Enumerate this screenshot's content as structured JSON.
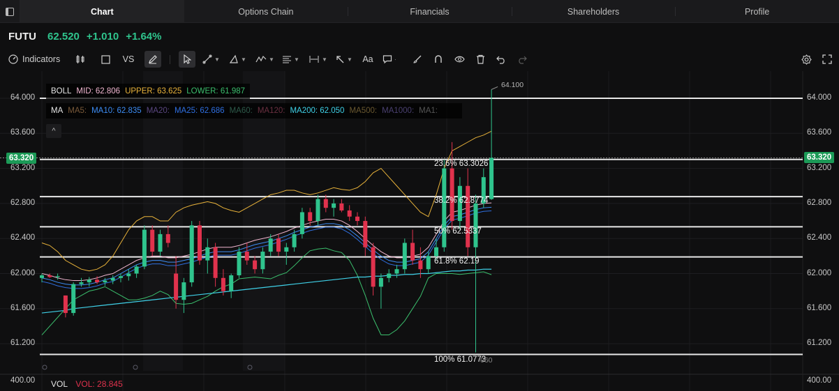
{
  "tabs": [
    {
      "label": "Chart"
    },
    {
      "label": "Options Chain"
    },
    {
      "label": "Financials"
    },
    {
      "label": "Shareholders"
    },
    {
      "label": "Profile"
    }
  ],
  "quote": {
    "symbol": "FUTU",
    "price": "62.520",
    "change": "+1.010",
    "change_pct": "+1.64%"
  },
  "toolbar": {
    "indicators_label": "Indicators",
    "compare_label": "VS",
    "text_label": "Aa"
  },
  "axis": {
    "left_ticks": [
      "64.000",
      "63.600",
      "63.200",
      "62.800",
      "62.400",
      "62.000",
      "61.600",
      "61.200"
    ],
    "right_ticks": [
      "64.000",
      "63.600",
      "63.200",
      "62.800",
      "62.400",
      "62.000",
      "61.600",
      "61.200"
    ],
    "current_price": "63.320",
    "volume_tick": "400.00"
  },
  "boll": {
    "label": "BOLL",
    "mid": "MID: 62.806",
    "upper": "UPPER: 63.625",
    "lower": "LOWER: 61.987"
  },
  "ma": {
    "label": "MA",
    "items": [
      "MA5:",
      "MA10: 62.835",
      "MA20:",
      "MA25: 62.686",
      "MA60:",
      "MA120:",
      "MA200: 62.050",
      "MA500:",
      "MA1000:",
      "MA1:"
    ]
  },
  "fib": {
    "l236": "23.6% 63.3026",
    "l382": "38.2% 62.8774",
    "l50": "50% 62.5337",
    "l618": "61.8% 62.19",
    "l100": "100% 61.0773",
    "overlap_label": "060"
  },
  "high_label": "64.100",
  "volume": {
    "label": "VOL",
    "value": "VOL: 28.845"
  },
  "colors": {
    "up": "#2fc48d",
    "down": "#e0324d",
    "boll_mid": "#f0b6d0",
    "boll_upper": "#e8b23a",
    "boll_lower": "#3bbf6d",
    "ma10": "#3d8df5",
    "ma25": "#2f6fe0",
    "ma200": "#3fd1e8"
  },
  "chart_data": {
    "type": "candlestick",
    "y_range": [
      61.0,
      64.1
    ],
    "bars": [
      [
        61.95,
        62.0,
        61.9,
        61.98
      ],
      [
        61.98,
        62.0,
        61.95,
        61.96
      ],
      [
        61.96,
        62.0,
        61.93,
        61.97
      ],
      [
        61.75,
        61.75,
        61.5,
        61.55
      ],
      [
        61.55,
        61.9,
        61.52,
        61.88
      ],
      [
        61.88,
        61.95,
        61.85,
        61.9
      ],
      [
        61.9,
        61.96,
        61.85,
        61.93
      ],
      [
        61.93,
        61.97,
        61.88,
        61.9
      ],
      [
        61.9,
        61.95,
        61.86,
        61.92
      ],
      [
        61.92,
        61.98,
        61.88,
        61.95
      ],
      [
        61.95,
        62.0,
        61.9,
        61.97
      ],
      [
        61.97,
        62.05,
        61.92,
        62.0
      ],
      [
        62.0,
        62.1,
        61.95,
        62.08
      ],
      [
        62.08,
        62.55,
        62.05,
        62.5
      ],
      [
        62.5,
        62.55,
        62.2,
        62.25
      ],
      [
        62.25,
        62.5,
        62.2,
        62.45
      ],
      [
        62.45,
        62.55,
        62.3,
        62.35
      ],
      [
        62.0,
        62.2,
        61.6,
        61.7
      ],
      [
        61.7,
        61.95,
        61.55,
        61.9
      ],
      [
        61.9,
        62.6,
        61.85,
        62.55
      ],
      [
        62.55,
        62.6,
        62.1,
        62.15
      ],
      [
        62.15,
        62.4,
        62.0,
        62.3
      ],
      [
        62.3,
        62.35,
        61.85,
        61.95
      ],
      [
        61.95,
        62.05,
        61.75,
        61.8
      ],
      [
        61.8,
        62.0,
        61.72,
        61.98
      ],
      [
        61.98,
        62.3,
        61.95,
        62.25
      ],
      [
        62.25,
        62.35,
        62.1,
        62.15
      ],
      [
        62.15,
        62.2,
        62.0,
        62.05
      ],
      [
        62.05,
        62.3,
        62.0,
        62.25
      ],
      [
        62.25,
        62.45,
        62.2,
        62.4
      ],
      [
        62.4,
        62.45,
        62.2,
        62.25
      ],
      [
        62.25,
        62.35,
        62.1,
        62.3
      ],
      [
        62.3,
        62.5,
        62.25,
        62.45
      ],
      [
        62.45,
        62.75,
        62.4,
        62.7
      ],
      [
        62.7,
        62.75,
        62.55,
        62.6
      ],
      [
        62.6,
        62.9,
        62.55,
        62.85
      ],
      [
        62.85,
        62.9,
        62.7,
        62.75
      ],
      [
        62.75,
        62.85,
        62.65,
        62.8
      ],
      [
        62.8,
        62.85,
        62.7,
        62.72
      ],
      [
        62.72,
        62.78,
        62.6,
        62.65
      ],
      [
        62.65,
        62.7,
        62.55,
        62.6
      ],
      [
        62.6,
        62.65,
        62.2,
        62.3
      ],
      [
        62.3,
        62.35,
        61.75,
        61.85
      ],
      [
        61.85,
        62.0,
        61.6,
        61.95
      ],
      [
        61.95,
        62.05,
        61.9,
        62.0
      ],
      [
        62.0,
        62.1,
        61.95,
        62.05
      ],
      [
        62.05,
        62.4,
        62.0,
        62.35
      ],
      [
        62.35,
        62.5,
        62.1,
        62.15
      ],
      [
        62.15,
        62.3,
        61.95,
        62.05
      ],
      [
        62.05,
        62.25,
        62.0,
        62.2
      ],
      [
        62.2,
        62.4,
        62.15,
        62.3
      ],
      [
        62.3,
        63.3,
        62.25,
        63.2
      ],
      [
        63.2,
        63.5,
        62.5,
        62.6
      ],
      [
        62.6,
        63.1,
        62.5,
        63.0
      ],
      [
        63.0,
        63.2,
        62.2,
        62.3
      ],
      [
        62.3,
        62.9,
        61.1,
        62.8
      ],
      [
        62.8,
        63.2,
        62.75,
        63.1
      ],
      [
        62.85,
        64.1,
        62.84,
        63.32
      ]
    ],
    "boll_upper": [
      62.35,
      62.32,
      62.25,
      62.15,
      62.1,
      62.05,
      62.03,
      62.05,
      62.1,
      62.2,
      62.35,
      62.5,
      62.6,
      62.65,
      62.65,
      62.6,
      62.6,
      62.7,
      62.75,
      62.78,
      62.8,
      62.82,
      62.8,
      62.75,
      62.72,
      62.7,
      62.75,
      62.8,
      62.85,
      62.9,
      62.92,
      62.95,
      62.95,
      62.92,
      62.9,
      62.92,
      62.95,
      62.98,
      62.96,
      62.95,
      62.98,
      63.05,
      63.15,
      63.2,
      63.1,
      63.0,
      62.9,
      62.8,
      62.7,
      62.65,
      62.9,
      63.2,
      63.4,
      63.45,
      63.5,
      63.55,
      63.58,
      63.625
    ],
    "boll_mid": [
      62.0,
      61.98,
      61.95,
      61.93,
      61.92,
      61.92,
      61.93,
      61.95,
      61.98,
      62.0,
      62.05,
      62.1,
      62.15,
      62.18,
      62.2,
      62.2,
      62.18,
      62.18,
      62.2,
      62.22,
      62.25,
      62.28,
      62.3,
      62.3,
      62.3,
      62.32,
      62.35,
      62.38,
      62.4,
      62.42,
      62.45,
      62.48,
      62.52,
      62.55,
      62.58,
      62.6,
      62.62,
      62.62,
      62.6,
      62.55,
      62.48,
      62.4,
      62.32,
      62.25,
      62.2,
      62.18,
      62.18,
      62.2,
      62.22,
      62.3,
      62.45,
      62.6,
      62.7,
      62.72,
      62.75,
      62.78,
      62.8,
      62.806
    ],
    "boll_lower": [
      61.3,
      61.4,
      61.5,
      61.6,
      61.7,
      61.75,
      61.8,
      61.82,
      61.85,
      61.8,
      61.75,
      61.7,
      61.7,
      61.72,
      61.75,
      61.8,
      61.76,
      61.66,
      61.65,
      61.66,
      61.7,
      61.74,
      61.8,
      61.85,
      61.88,
      61.94,
      61.95,
      61.96,
      61.95,
      61.94,
      61.98,
      62.01,
      62.09,
      62.18,
      62.26,
      62.28,
      62.29,
      62.26,
      62.24,
      62.15,
      61.98,
      61.75,
      61.49,
      61.3,
      61.3,
      61.36,
      61.46,
      61.6,
      61.74,
      61.95,
      62.0,
      62.0,
      62.0,
      61.99,
      62.0,
      62.01,
      62.02,
      61.987
    ],
    "ma200": [
      61.55,
      61.56,
      61.57,
      61.58,
      61.6,
      61.61,
      61.62,
      61.63,
      61.64,
      61.65,
      61.66,
      61.67,
      61.68,
      61.69,
      61.7,
      61.71,
      61.72,
      61.73,
      61.74,
      61.75,
      61.76,
      61.77,
      61.78,
      61.79,
      61.8,
      61.81,
      61.82,
      61.83,
      61.84,
      61.85,
      61.86,
      61.87,
      61.88,
      61.89,
      61.9,
      61.91,
      61.92,
      61.93,
      61.94,
      61.95,
      61.96,
      61.96,
      61.97,
      61.97,
      61.98,
      61.98,
      61.99,
      61.99,
      62.0,
      62.0,
      62.01,
      62.02,
      62.03,
      62.03,
      62.04,
      62.04,
      62.05,
      62.05
    ],
    "fib_levels": [
      63.3026,
      62.8774,
      62.5337,
      62.19,
      61.0773
    ],
    "high": 64.1
  }
}
